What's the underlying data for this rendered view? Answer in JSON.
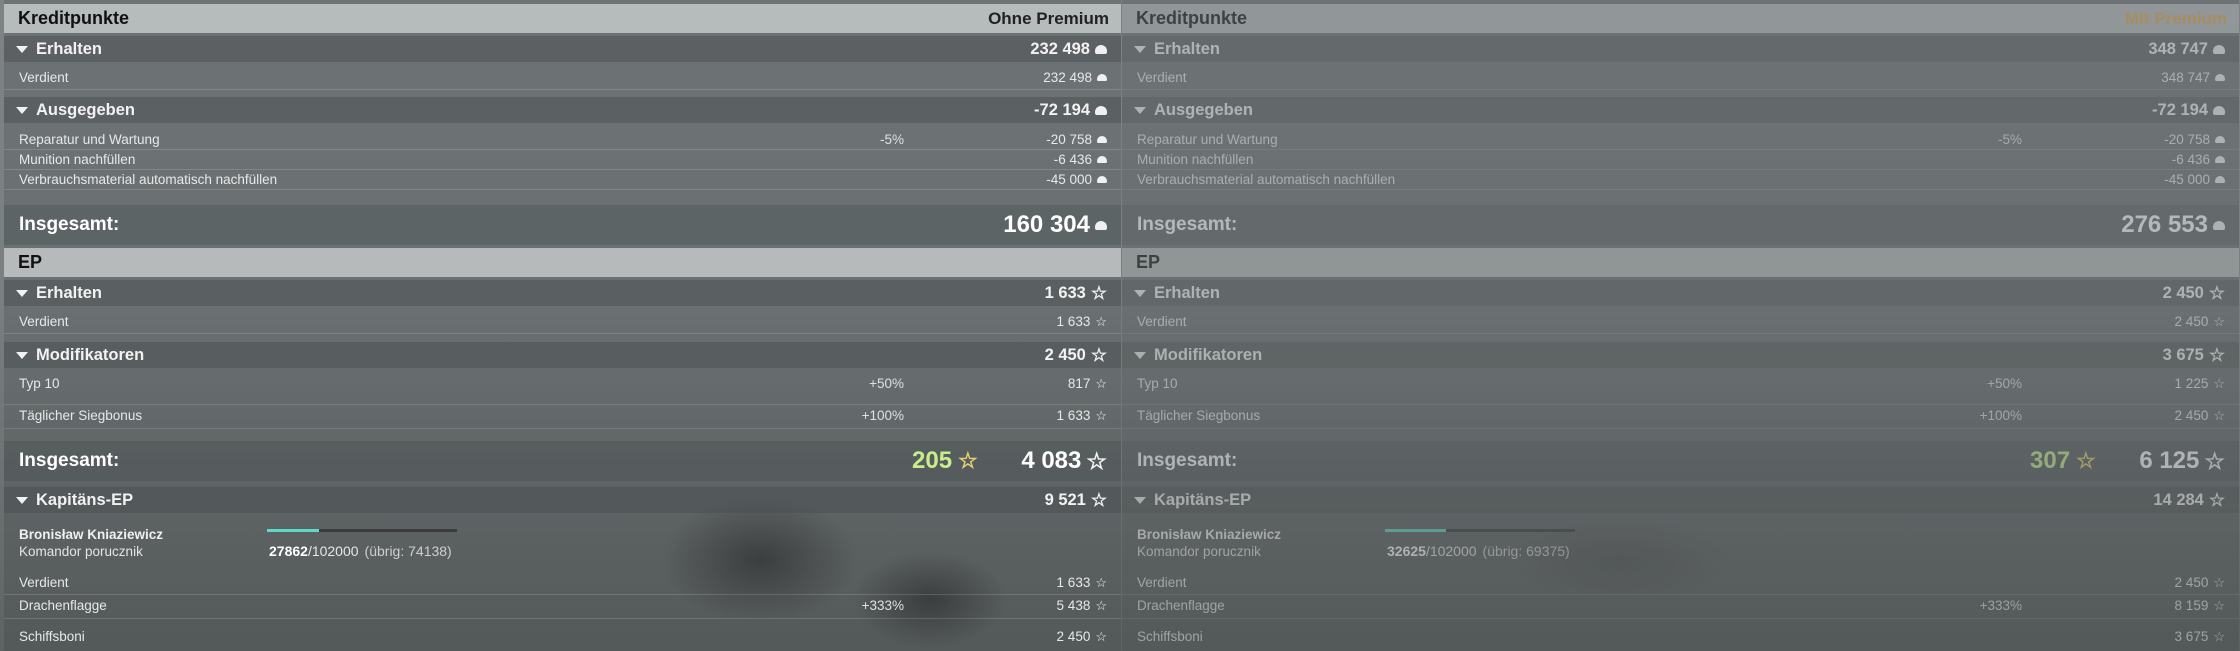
{
  "panels": [
    {
      "credits": {
        "title": "Kreditpunkte",
        "account": "Ohne Premium",
        "earned_group": {
          "label": "Erhalten",
          "value": "232 498"
        },
        "earned": {
          "label": "Verdient",
          "value": "232 498"
        },
        "spent_group": {
          "label": "Ausgegeben",
          "value": "-72 194"
        },
        "spent_items": [
          {
            "label": "Reparatur und Wartung",
            "pct": "-5%",
            "value": "-20 758"
          },
          {
            "label": "Munition nachfüllen",
            "pct": "",
            "value": "-6 436"
          },
          {
            "label": "Verbrauchsmaterial automatisch nachfüllen",
            "pct": "",
            "value": "-45 000"
          }
        ],
        "total": {
          "label": "Insgesamt:",
          "value": "160 304"
        }
      },
      "ep": {
        "title": "EP",
        "earned_group": {
          "label": "Erhalten",
          "value": "1 633"
        },
        "earned": {
          "label": "Verdient",
          "value": "1 633"
        },
        "mod_group": {
          "label": "Modifikatoren",
          "value": "2 450"
        },
        "mod_items": [
          {
            "label": "Typ 10",
            "pct": "+50%",
            "value": "817"
          },
          {
            "label": "Täglicher Siegbonus",
            "pct": "+100%",
            "value": "1 633"
          }
        ],
        "total": {
          "label": "Insgesamt:",
          "free": "205",
          "value": "4 083"
        }
      },
      "captain": {
        "group": {
          "label": "Kapitäns-EP",
          "value": "9 521"
        },
        "name": "Bronisław Kniaziewicz",
        "rank": "Komandor porucznik",
        "xp_current": "27862",
        "xp_max": "/102000",
        "xp_rest": "(übrig: 74138)",
        "progress": 0.273,
        "items": [
          {
            "label": "Verdient",
            "pct": "",
            "value": "1 633"
          },
          {
            "label": "Drachenflagge",
            "pct": "+333%",
            "value": "5 438"
          },
          {
            "label": "Schiffsboni",
            "pct": "",
            "value": "2 450"
          }
        ]
      }
    },
    {
      "credits": {
        "title": "Kreditpunkte",
        "account": "Mit Premium",
        "earned_group": {
          "label": "Erhalten",
          "value": "348 747"
        },
        "earned": {
          "label": "Verdient",
          "value": "348 747"
        },
        "spent_group": {
          "label": "Ausgegeben",
          "value": "-72 194"
        },
        "spent_items": [
          {
            "label": "Reparatur und Wartung",
            "pct": "-5%",
            "value": "-20 758"
          },
          {
            "label": "Munition nachfüllen",
            "pct": "",
            "value": "-6 436"
          },
          {
            "label": "Verbrauchsmaterial automatisch nachfüllen",
            "pct": "",
            "value": "-45 000"
          }
        ],
        "total": {
          "label": "Insgesamt:",
          "value": "276 553"
        }
      },
      "ep": {
        "title": "EP",
        "earned_group": {
          "label": "Erhalten",
          "value": "2 450"
        },
        "earned": {
          "label": "Verdient",
          "value": "2 450"
        },
        "mod_group": {
          "label": "Modifikatoren",
          "value": "3 675"
        },
        "mod_items": [
          {
            "label": "Typ 10",
            "pct": "+50%",
            "value": "1 225"
          },
          {
            "label": "Täglicher Siegbonus",
            "pct": "+100%",
            "value": "2 450"
          }
        ],
        "total": {
          "label": "Insgesamt:",
          "free": "307",
          "value": "6 125"
        }
      },
      "captain": {
        "group": {
          "label": "Kapitäns-EP",
          "value": "14 284"
        },
        "name": "Bronisław Kniaziewicz",
        "rank": "Komandor porucznik",
        "xp_current": "32625",
        "xp_max": "/102000",
        "xp_rest": "(übrig: 69375)",
        "progress": 0.32,
        "items": [
          {
            "label": "Verdient",
            "pct": "",
            "value": "2 450"
          },
          {
            "label": "Drachenflagge",
            "pct": "+333%",
            "value": "8 159"
          },
          {
            "label": "Schiffsboni",
            "pct": "",
            "value": "3 675"
          }
        ]
      }
    }
  ]
}
